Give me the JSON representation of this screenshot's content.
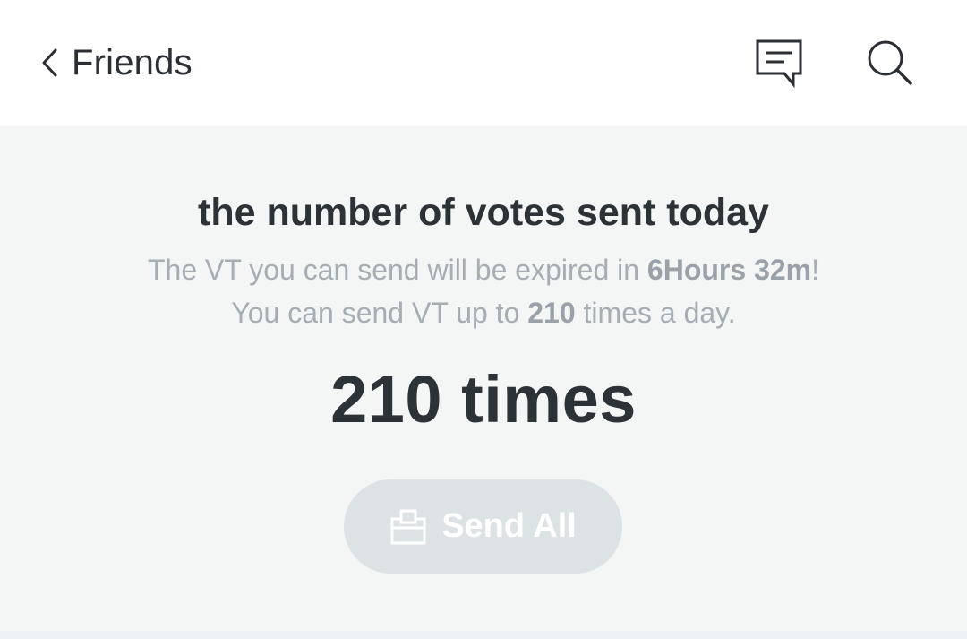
{
  "header": {
    "back_icon": "chevron-left-icon",
    "title": "Friends",
    "message_icon": "message-icon",
    "search_icon": "search-icon"
  },
  "votes": {
    "title": "the number of votes sent today",
    "line1_prefix": "The VT you can send will be expired in ",
    "line1_bold": "6Hours 32m",
    "line1_suffix": "!",
    "line2_prefix": "You can send VT up to ",
    "line2_bold": "210",
    "line2_suffix": " times a day.",
    "count": "210 times"
  },
  "send_all": {
    "icon": "ballot-box-icon",
    "label": "Send All"
  },
  "colors": {
    "header_bg": "#ffffff",
    "panel_bg": "#f4f5f5",
    "title_text": "#2d3237",
    "muted_text": "#a6adb3",
    "button_bg": "#dde2e5",
    "button_text": "#ffffff"
  }
}
